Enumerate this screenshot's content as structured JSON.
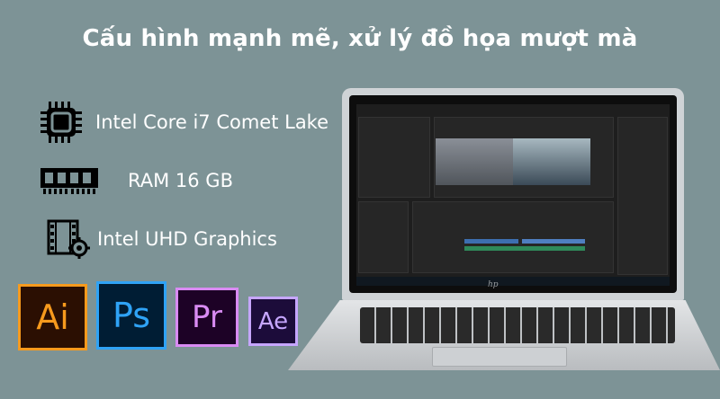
{
  "headline": "Cấu hình mạnh mẽ, xử lý đồ họa mượt mà",
  "specs": [
    {
      "icon": "cpu-chip-icon",
      "label": "Intel Core i7 Comet Lake"
    },
    {
      "icon": "ram-module-icon",
      "label": "RAM 16 GB"
    },
    {
      "icon": "graphics-film-gear-icon",
      "label": "Intel UHD Graphics"
    }
  ],
  "apps": [
    {
      "icon": "adobe-illustrator-icon",
      "text": "Ai",
      "color": "#f79a1d"
    },
    {
      "icon": "adobe-photoshop-icon",
      "text": "Ps",
      "color": "#2fa3f6"
    },
    {
      "icon": "adobe-premiere-icon",
      "text": "Pr",
      "color": "#d98bf3"
    },
    {
      "icon": "adobe-after-effects-icon",
      "text": "Ae",
      "color": "#c6a6ff"
    }
  ],
  "laptop": {
    "brand": "hp"
  },
  "colors": {
    "background": "#7d9396",
    "text": "#ffffff"
  }
}
